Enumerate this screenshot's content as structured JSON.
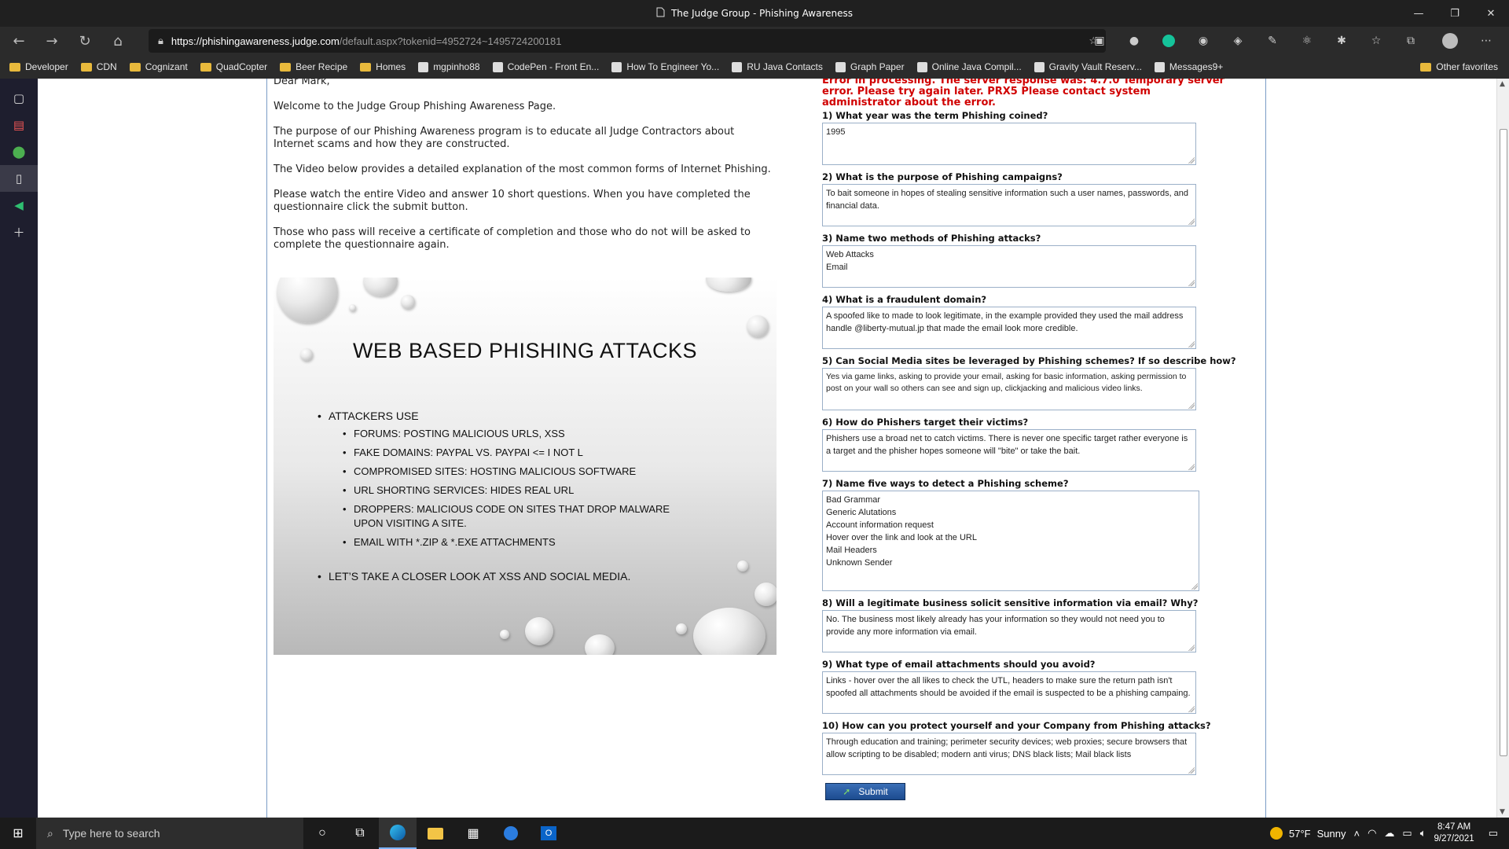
{
  "window": {
    "title": "The Judge Group - Phishing Awareness"
  },
  "address": {
    "host": "https://phishingawareness.judge.com",
    "path": "/default.aspx?tokenid=4952724~1495724200181"
  },
  "bookmarks": [
    {
      "label": "Developer",
      "icon": "folder-icon"
    },
    {
      "label": "CDN",
      "icon": "folder-icon"
    },
    {
      "label": "Cognizant",
      "icon": "folder-icon"
    },
    {
      "label": "QuadCopter",
      "icon": "folder-icon"
    },
    {
      "label": "Beer Recipe",
      "icon": "folder-icon"
    },
    {
      "label": "Homes",
      "icon": "folder-icon"
    },
    {
      "label": "mgpinho88",
      "icon": "github-icon"
    },
    {
      "label": "CodePen - Front En...",
      "icon": "codepen-icon"
    },
    {
      "label": "How To Engineer Yo...",
      "icon": "page-icon"
    },
    {
      "label": "RU Java Contacts",
      "icon": "doc-icon"
    },
    {
      "label": "Graph Paper",
      "icon": "page-icon"
    },
    {
      "label": "Online Java Compil...",
      "icon": "page-icon"
    },
    {
      "label": "Gravity Vault Reserv...",
      "icon": "page-icon"
    },
    {
      "label": "Messages9+",
      "icon": "page-icon"
    }
  ],
  "other_favorites": "Other favorites",
  "intro": {
    "greeting": "Dear Mark,",
    "welcome": "Welcome to the Judge Group Phishing Awareness Page.",
    "purpose": "The purpose of our Phishing Awareness program is to educate all Judge Contractors about Internet scams and how they are constructed.",
    "video": "The Video below provides a detailed explanation of the most common forms of Internet Phishing.",
    "instructions": "Please watch the entire Video and answer 10 short questions. When you have completed the questionnaire click the submit button.",
    "pass": "Those who pass will receive a certificate of completion and those who do not will be asked to complete the questionnaire again."
  },
  "slide": {
    "title": "WEB BASED PHISHING ATTACKS",
    "heading1": "ATTACKERS USE",
    "items": [
      "FORUMS: POSTING MALICIOUS URLS, XSS",
      "FAKE DOMAINS: PAYPAL VS. PAYPAI <= I NOT L",
      "COMPROMISED SITES: HOSTING MALICIOUS SOFTWARE",
      "URL SHORTING SERVICES: HIDES REAL URL",
      "DROPPERS: MALICIOUS CODE ON SITES THAT DROP MALWARE UPON VISITING A SITE.",
      "EMAIL WITH *.ZIP & *.EXE ATTACHMENTS"
    ],
    "heading2": "LET’S TAKE A CLOSER LOOK AT XSS AND SOCIAL MEDIA."
  },
  "error": "Error in processing. The server response was: 4.7.0 Temporary server error. Please try again later. PRX5 Please contact system administrator about the error.",
  "questions": [
    {
      "q": "1) What year was the term Phishing coined?",
      "a": "1995"
    },
    {
      "q": "2) What is the purpose of Phishing campaigns?",
      "a": "To bait someone in hopes of stealing sensitive information such a user names, passwords, and financial data."
    },
    {
      "q": "3) Name two methods of Phishing attacks?",
      "a": "Web Attacks\nEmail"
    },
    {
      "q": "4) What is a fraudulent domain?",
      "a": "A spoofed like to made to look legitimate, in the example provided they used the mail address handle @liberty-mutual.jp that made the email look more credible."
    },
    {
      "q": "5) Can Social Media sites be leveraged by Phishing schemes? If so describe how?",
      "a": "Yes via game links, asking to provide your email, asking for basic information, asking permission to post on your wall so others can see and sign up, clickjacking and malicious video links."
    },
    {
      "q": "6) How do Phishers target their victims?",
      "a": "Phishers use a broad net to catch victims. There is never one specific target rather everyone is a target and the phisher hopes someone will \"bite\" or take the bait."
    },
    {
      "q": "7) Name five ways to detect a Phishing scheme?",
      "a": "Bad Grammar\nGeneric Alutations\nAccount information request\nHover over the link and look at the URL\nMail Headers\nUnknown Sender"
    },
    {
      "q": "8) Will a legitimate business solicit sensitive information via email? Why?",
      "a": "No. The business most likely already has your information so they would not need you to provide any more information via email."
    },
    {
      "q": "9) What type of email attachments should you avoid?",
      "a": "Links - hover over the all likes to check the UTL, headers to make sure the return path isn't spoofed all attachments should be avoided if the email is suspected to be a phishing campaing."
    },
    {
      "q": "10) How can you protect yourself and your Company from Phishing attacks?",
      "a": "Through education and training; perimeter security devices; web proxies; secure browsers that allow scripting to be disabled; modern anti virus; DNS black lists; Mail black lists"
    }
  ],
  "submit_label": "Submit",
  "taskbar": {
    "search_placeholder": "Type here to search",
    "weather_temp": "57°F",
    "weather_cond": "Sunny",
    "time": "8:47 AM",
    "date": "9/27/2021"
  },
  "colors": {
    "error": "#d00000",
    "accent": "#1c4b8f",
    "chrome": "#2b2b2b"
  }
}
